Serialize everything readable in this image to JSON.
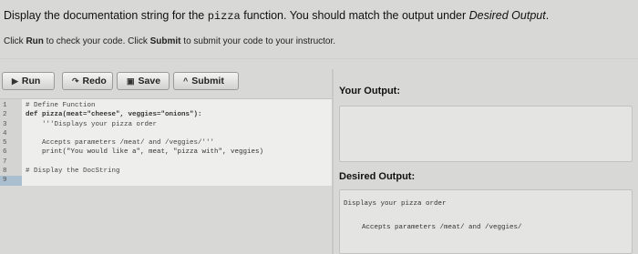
{
  "instruction": {
    "prefix": "Display the documentation string for the ",
    "func": "pizza",
    "middle": " function. You should match the output under ",
    "emph": "Desired Output",
    "suffix": "."
  },
  "subinstruction": {
    "click1": "Click ",
    "run": "Run",
    "mid": " to check your code. Click ",
    "submit": "Submit",
    "end": " to submit your code to your instructor."
  },
  "toolbar": {
    "run_label": "Run",
    "redo_label": "Redo",
    "save_label": "Save",
    "submit_label": "Submit",
    "run_icon": "play-icon",
    "redo_icon": "redo-icon",
    "save_icon": "save-icon",
    "submit_icon": "up-caret-icon"
  },
  "editor": {
    "line_numbers": [
      "1",
      "2",
      "3",
      "4",
      "5",
      "6",
      "7",
      "8",
      "9"
    ],
    "lines": [
      "# Define Function",
      "def pizza(meat=\"cheese\", veggies=\"onions\"):",
      "    '''Displays your pizza order",
      "",
      "    Accepts parameters /meat/ and /veggies/'''",
      "    print(\"You would like a\", meat, \"pizza with\", veggies)",
      "",
      "# Display the DocString",
      ""
    ]
  },
  "output": {
    "your_output_label": "Your Output:",
    "your_output_value": "",
    "desired_output_label": "Desired Output:",
    "desired_line1": "Displays your pizza order",
    "desired_line2": "Accepts parameters /meat/ and /veggies/"
  }
}
